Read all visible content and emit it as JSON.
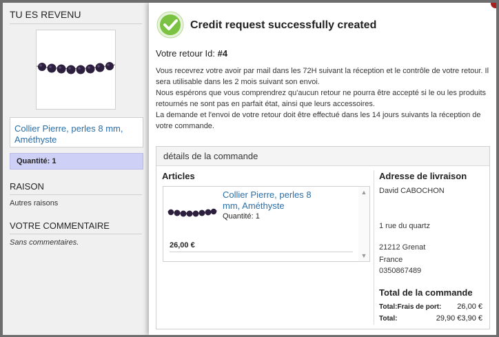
{
  "sidebar": {
    "title": "TU ES REVENU",
    "product_name": "Collier Pierre, perles 8 mm, Améthyste",
    "quantity": "Quantité: 1",
    "reason_head": "RAISON",
    "reason_text": "Autres raisons",
    "comment_head": "VOTRE COMMENTAIRE",
    "comment_text": "Sans commentaires."
  },
  "modal": {
    "title": "Credit request successfully created",
    "retour_label": "Votre retour Id: ",
    "retour_id": "#4",
    "para1": "Vous recevrez votre avoir par mail dans les 72H suivant la réception et le contrôle de votre retour. Il sera utilisable dans les 2 mois suivant son envoi.",
    "para2": "Nous espérons que vous comprendrez qu'aucun retour ne pourra être accepté si le ou les produits retournés ne sont pas en parfait état, ainsi que leurs accessoires.",
    "para3": "La demande et l'envoi de votre retour doit être effectué dans les 14 jours suivants la réception de votre commande."
  },
  "order": {
    "header": "détails de la commande",
    "articles_head": "Articles",
    "item": {
      "name": "Collier Pierre, perles 8 mm, Améthyste",
      "quantity": "Quantité: 1",
      "price": "26,00 €"
    },
    "address_head": "Adresse de livraison",
    "address": [
      "David CABOCHON",
      "1 rue du quartz",
      "21212 Grenat",
      "France",
      "0350867489"
    ],
    "total_head": "Total de la commande",
    "totals": [
      {
        "label": "Total:Frais de port:",
        "value": "26,00 €"
      },
      {
        "label": "Total:",
        "value": "29,90 €3,90 €"
      }
    ]
  },
  "colors": {
    "accent_blue": "#2a6ea8",
    "success_green": "#7cc242",
    "quantity_bg": "#cfd0f5",
    "bead": "#2c1f3d"
  },
  "icons": {
    "success": "check-circle-icon",
    "scroll_up": "triangle-up-icon",
    "scroll_down": "triangle-down-icon"
  }
}
